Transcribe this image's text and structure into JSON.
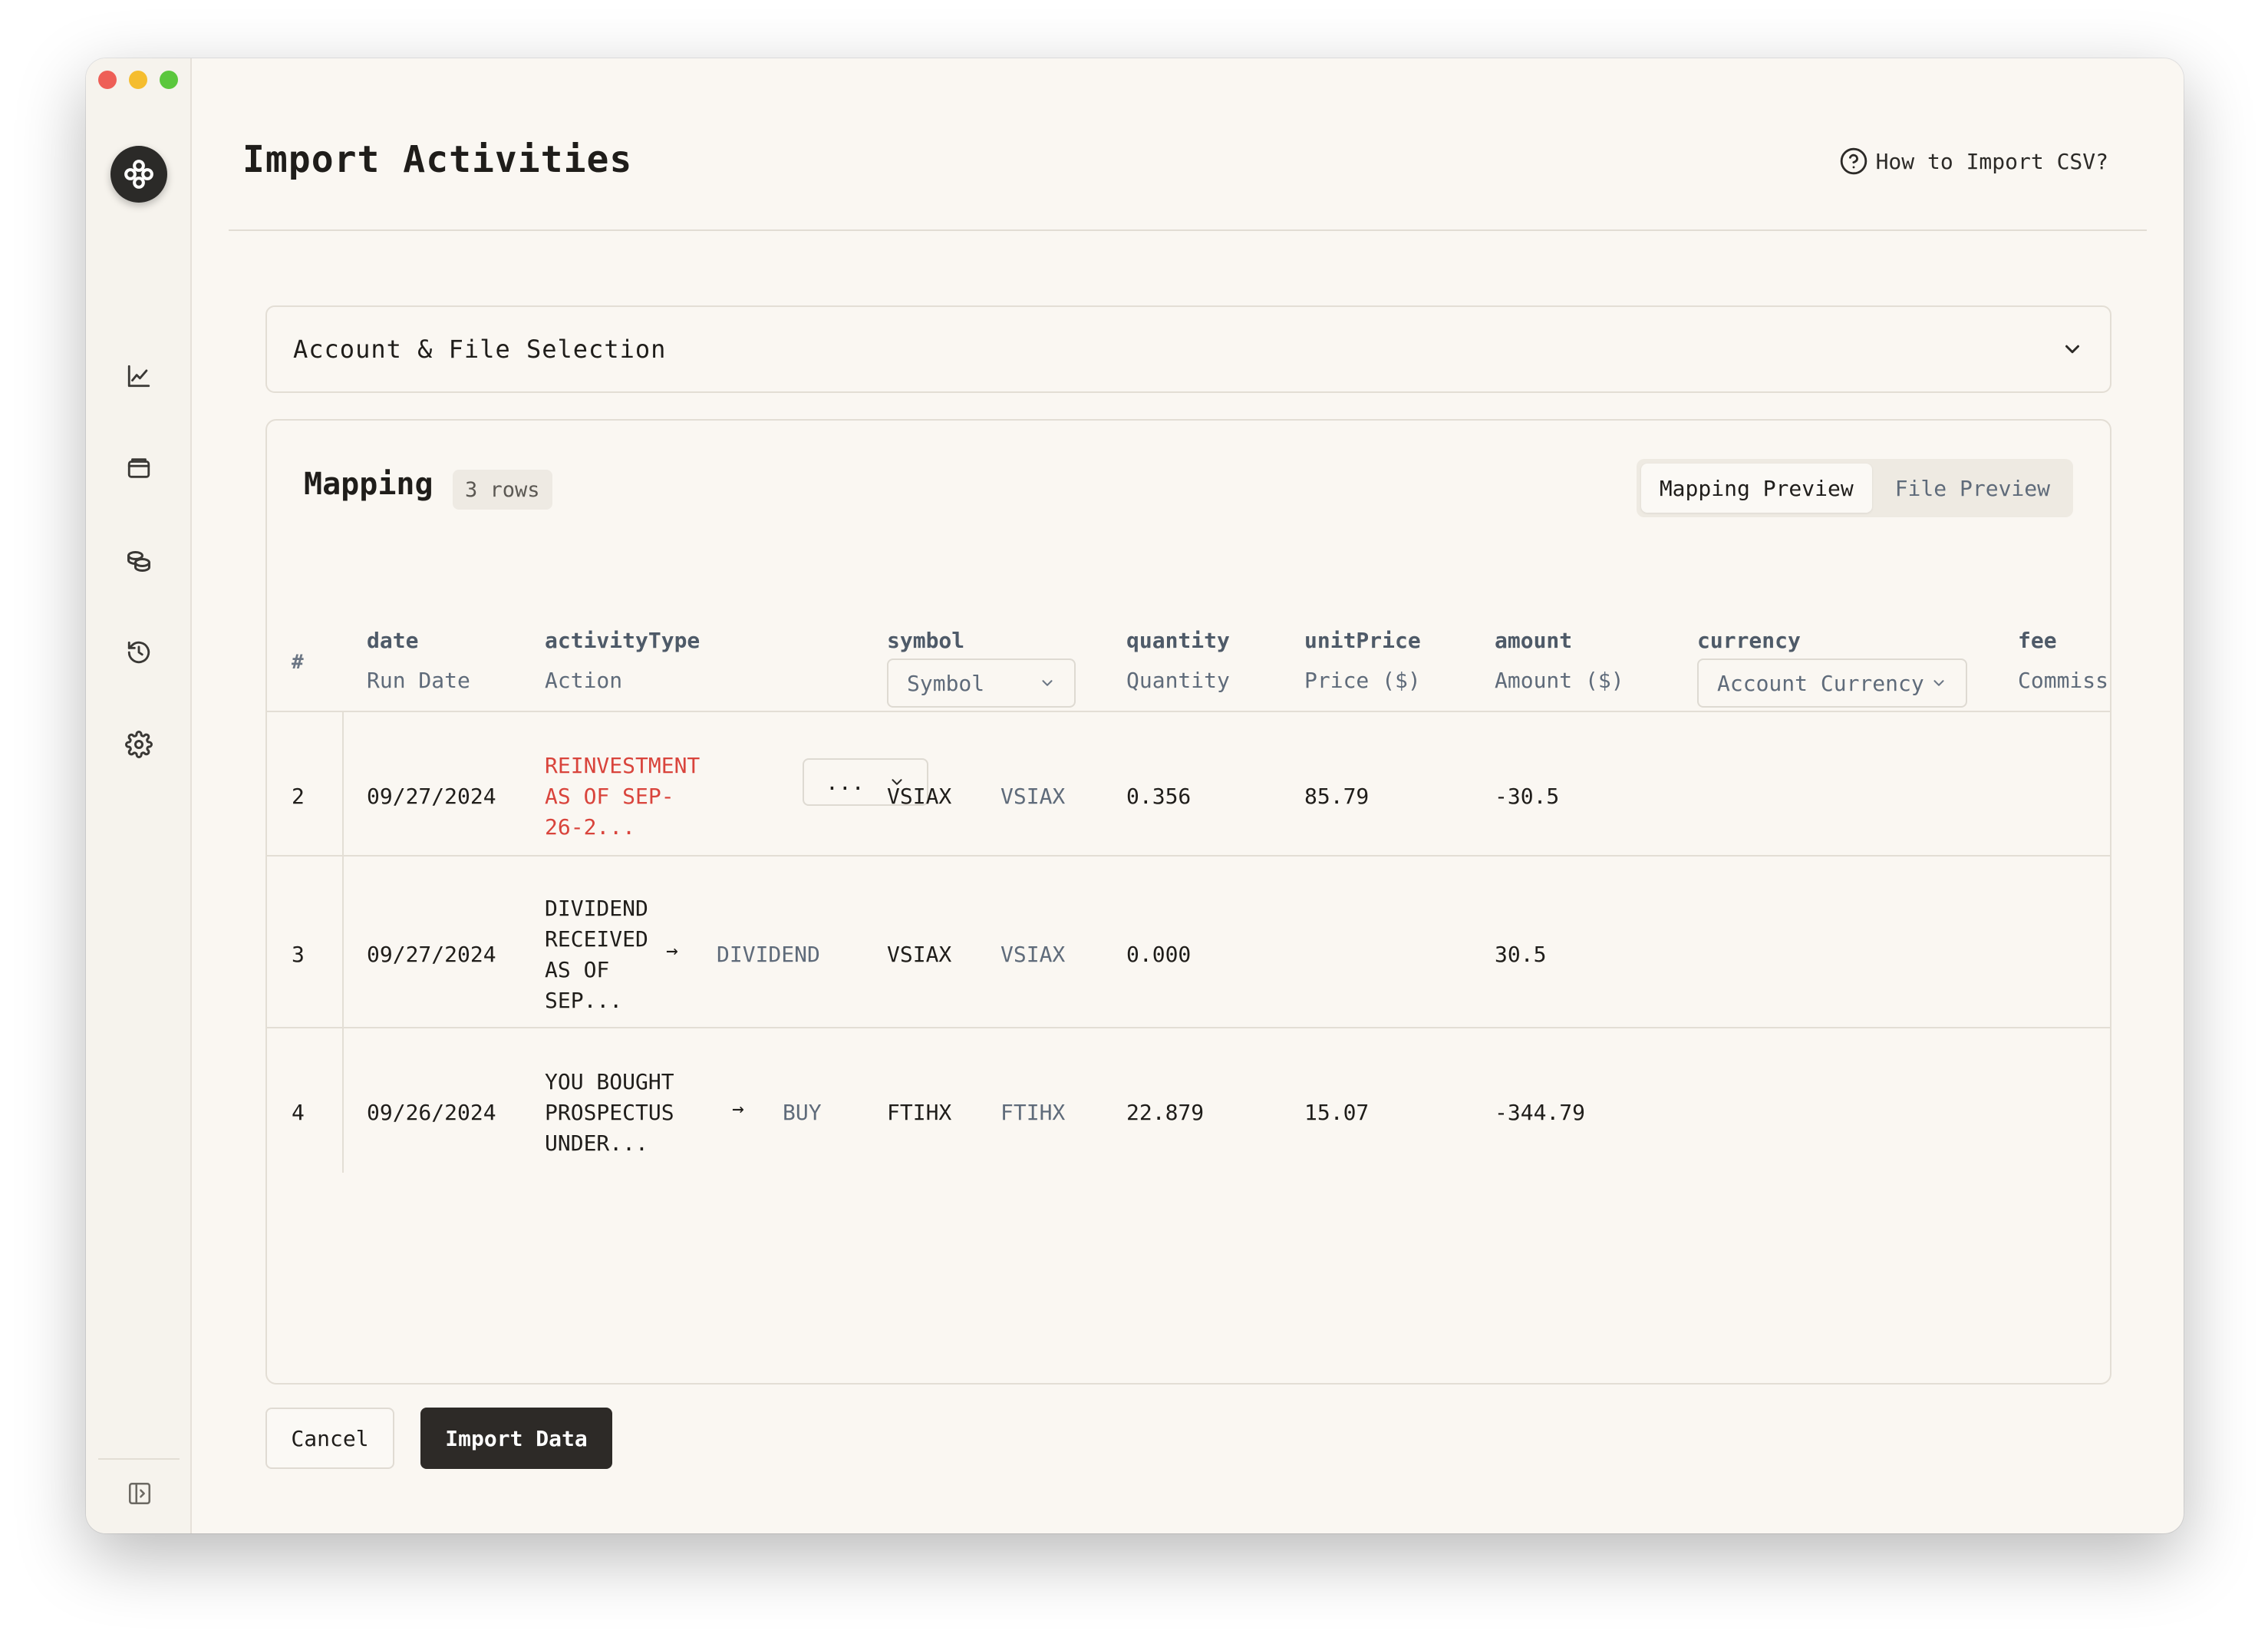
{
  "header": {
    "title": "Import Activities",
    "help_link": "How to Import CSV?"
  },
  "accordion": {
    "title": "Account & File Selection"
  },
  "mapping": {
    "title": "Mapping",
    "rows_badge": "3 rows",
    "tabs": [
      {
        "label": "Mapping Preview",
        "active": true
      },
      {
        "label": "File Preview",
        "active": false
      }
    ],
    "row_number_header": "#",
    "columns": [
      {
        "key": "date",
        "sub": "Run Date"
      },
      {
        "key": "activityType",
        "sub": "Action"
      },
      {
        "key": "symbol",
        "sub": "Symbol"
      },
      {
        "key": "quantity",
        "sub": "Quantity"
      },
      {
        "key": "unitPrice",
        "sub": "Price ($)"
      },
      {
        "key": "amount",
        "sub": "Amount ($)"
      },
      {
        "key": "currency",
        "sub": "Account Currency"
      },
      {
        "key": "fee",
        "sub": "Commiss"
      }
    ],
    "rows": [
      {
        "num": "2",
        "date": "09/27/2024",
        "action_lines": [
          "REINVESTMENT",
          "AS OF SEP-",
          "26-2..."
        ],
        "mapped_type": "...",
        "symbol_raw": "VSIAX",
        "symbol_mapped": "VSIAX",
        "quantity": "0.356",
        "unit_price": "85.79",
        "amount": "-30.5"
      },
      {
        "num": "3",
        "date": "09/27/2024",
        "action_lines": [
          "DIVIDEND",
          "RECEIVED",
          "AS OF",
          "SEP..."
        ],
        "arrow": "→",
        "mapped_type": "DIVIDEND",
        "symbol_raw": "VSIAX",
        "symbol_mapped": "VSIAX",
        "quantity": "0.000",
        "unit_price": "",
        "amount": "30.5"
      },
      {
        "num": "4",
        "date": "09/26/2024",
        "action_lines": [
          "YOU BOUGHT",
          "PROSPECTUS",
          "UNDER..."
        ],
        "arrow": "→",
        "mapped_type": "BUY",
        "symbol_raw": "FTIHX",
        "symbol_mapped": "FTIHX",
        "quantity": "22.879",
        "unit_price": "15.07",
        "amount": "-344.79"
      }
    ]
  },
  "actions": {
    "cancel": "Cancel",
    "import": "Import Data"
  },
  "colors": {
    "accent_dark": "#2d2a27",
    "warning_red": "#d9443c",
    "muted_text": "#5f6b7a"
  },
  "icons": {
    "logo": "app-logo-icon",
    "nav": [
      "chart-icon",
      "wallet-icon",
      "coins-icon",
      "history-icon",
      "gear-icon"
    ],
    "collapse": "sidebar-toggle-icon",
    "help": "question-circle-icon",
    "chevron": "chevron-down-icon"
  }
}
